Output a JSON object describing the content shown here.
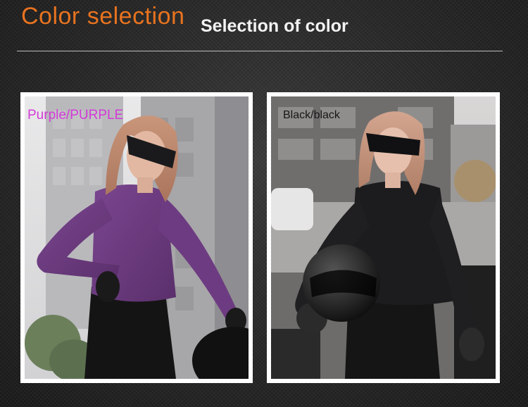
{
  "header": {
    "title": "Color selection",
    "subtitle": "Selection of color"
  },
  "colors": {
    "title_accent": "#e8731f",
    "purple_label": "#d43ad8",
    "purple_jacket": "#6a3a7c",
    "black_jacket": "#1c1c1e"
  },
  "options": [
    {
      "label": "Purple/PURPLE"
    },
    {
      "label": "Black/black"
    }
  ]
}
